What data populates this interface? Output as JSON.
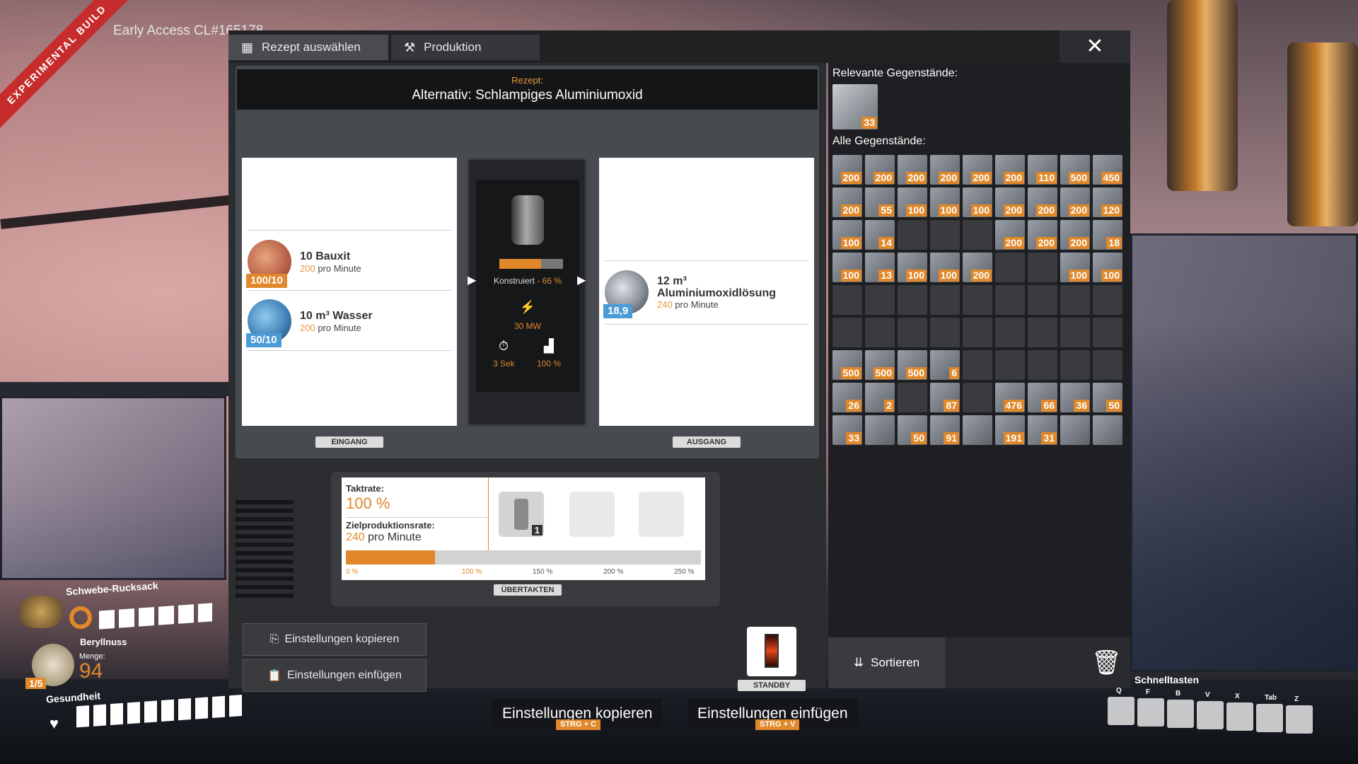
{
  "overlay": {
    "build_banner": "EXPERIMENTAL BUILD",
    "build_label": "Early Access CL#165178"
  },
  "tabs": [
    {
      "label": "Rezept auswählen",
      "icon": "grid-icon"
    },
    {
      "label": "Produktion",
      "icon": "hammer-icon"
    }
  ],
  "recipe": {
    "label": "Rezept:",
    "name": "Alternativ: Schlampiges Aluminiumoxid"
  },
  "inputs": [
    {
      "name": "10 Bauxit",
      "rate": "200",
      "rate_unit": "pro Minute",
      "count": "100/10",
      "badge_color": "#e0882a"
    },
    {
      "name": "10 m³ Wasser",
      "rate": "200",
      "rate_unit": "pro Minute",
      "count": "50/10",
      "badge_color": "#4a9bd6"
    }
  ],
  "input_tag": "EINGANG",
  "output": {
    "name": "12 m³ Aluminiumoxidlösung",
    "rate": "240",
    "rate_unit": "pro Minute",
    "count": "18,9"
  },
  "output_tag": "AUSGANG",
  "machine": {
    "status": "Konstruiert",
    "progress_label": "66 %",
    "progress": 0.66,
    "power": "30 MW",
    "time": "3 Sek",
    "efficiency": "100 %"
  },
  "overclock": {
    "clock_label": "Taktrate:",
    "clock_value": "100 %",
    "target_label": "Zielproduktionsrate:",
    "target_value": "240",
    "target_unit": "pro Minute",
    "shard_count": "1",
    "fill": 0.25,
    "ticks": [
      "0 %",
      "100 %",
      "150 %",
      "200 %",
      "250 %"
    ],
    "button": "ÜBERTAKTEN"
  },
  "buttons": {
    "copy": "Einstellungen kopieren",
    "paste": "Einstellungen einfügen",
    "standby": "STANDBY"
  },
  "right": {
    "relevant_label": "Relevante Gegenstände:",
    "relevant_count": "33",
    "all_label": "Alle Gegenstände:",
    "sort": "Sortieren",
    "grid": [
      [
        "200",
        "200",
        "200",
        "200",
        "200",
        "200",
        "110",
        "500",
        "450"
      ],
      [
        "200",
        "55",
        "100",
        "100",
        "100",
        "200",
        "200",
        "200",
        "120"
      ],
      [
        "100",
        "14",
        "",
        "",
        "",
        "200",
        "200",
        "200",
        "18"
      ],
      [
        "100",
        "13",
        "100",
        "100",
        "200",
        "",
        "",
        "100",
        "100"
      ],
      [
        "",
        "",
        "",
        "",
        "",
        "",
        "",
        "",
        ""
      ],
      [
        "",
        "",
        "",
        "",
        "",
        "",
        "",
        "",
        ""
      ],
      [
        "500",
        "500",
        "500",
        "6",
        "",
        "",
        "",
        "",
        ""
      ],
      [
        "26",
        "2",
        "",
        "87",
        "",
        "476",
        "66",
        "36",
        "50"
      ],
      [
        "33",
        "",
        "50",
        "91",
        "",
        "191",
        "31",
        "",
        ""
      ]
    ],
    "filled": [
      [
        1,
        1,
        1,
        1,
        1,
        1,
        1,
        1,
        1
      ],
      [
        1,
        1,
        1,
        1,
        1,
        1,
        1,
        1,
        1
      ],
      [
        1,
        1,
        0,
        0,
        0,
        1,
        1,
        1,
        1
      ],
      [
        1,
        1,
        1,
        1,
        1,
        0,
        0,
        1,
        1
      ],
      [
        0,
        0,
        0,
        0,
        0,
        0,
        0,
        0,
        0
      ],
      [
        0,
        0,
        0,
        0,
        0,
        0,
        0,
        0,
        0
      ],
      [
        1,
        1,
        1,
        1,
        0,
        0,
        0,
        0,
        0
      ],
      [
        1,
        1,
        0,
        1,
        0,
        1,
        1,
        1,
        1
      ],
      [
        1,
        1,
        1,
        1,
        1,
        1,
        1,
        1,
        1
      ]
    ]
  },
  "hud": {
    "backpack": "Schwebe-Rucksack",
    "item": "Beryllnuss",
    "amount_label": "Menge:",
    "amount": "94",
    "stack": "1/5",
    "health": "Gesundheit",
    "shortcuts": "Schnelltasten",
    "keys": [
      "Q",
      "F",
      "B",
      "V",
      "X",
      "Tab",
      "Z"
    ]
  },
  "hints": [
    {
      "label": "Einstellungen kopieren",
      "key": "STRG + C"
    },
    {
      "label": "Einstellungen einfügen",
      "key": "STRG + V"
    }
  ]
}
